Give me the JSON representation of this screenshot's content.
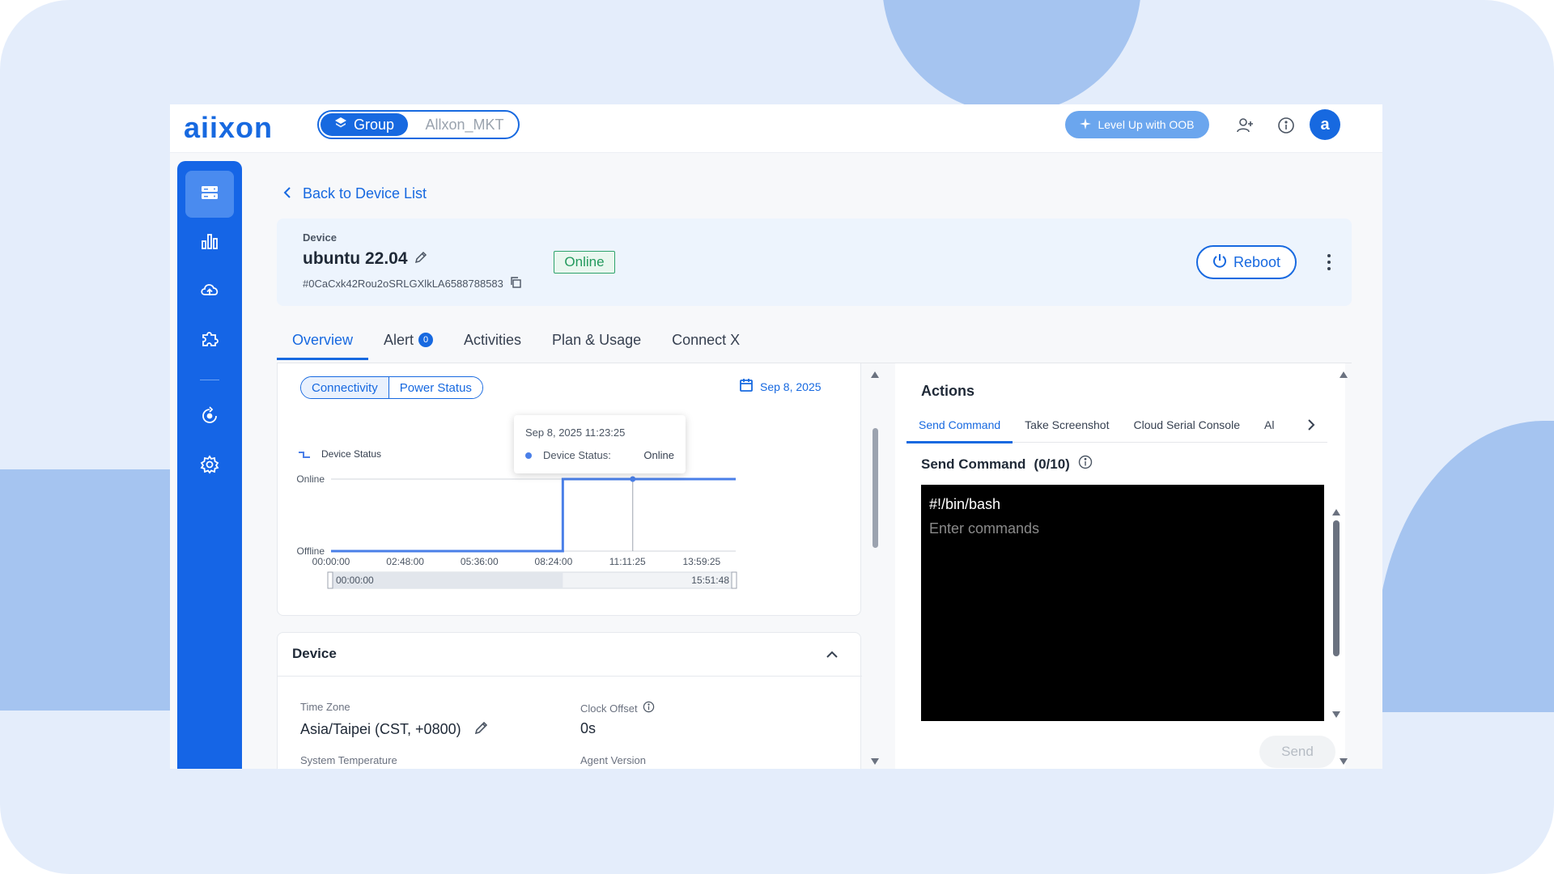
{
  "brand": {
    "logo_text": "aiixon",
    "accent": "#1769e0",
    "online_color": "#239a5d"
  },
  "topbar": {
    "group_label": "Group",
    "group_name": "Allxon_MKT",
    "levelup_label": "Level Up with OOB",
    "avatar_letter": "a",
    "icons": [
      "layers-icon",
      "sparkle-icon",
      "add-user-icon",
      "info-icon"
    ]
  },
  "sidebar": {
    "items": [
      {
        "icon": "devices-icon",
        "active": true
      },
      {
        "icon": "bar-chart-icon",
        "active": false
      },
      {
        "icon": "cloud-icon",
        "active": false
      },
      {
        "icon": "puzzle-icon",
        "active": false
      },
      {
        "icon": "sync-icon",
        "active": false
      },
      {
        "icon": "settings-icon",
        "active": false
      }
    ]
  },
  "header": {
    "back_label": "Back to Device List",
    "device_label": "Device",
    "device_name": "ubuntu 22.04",
    "device_id": "#0CaCxk42Rou2oSRLGXlkLA6588788583",
    "status": "Online",
    "reboot_label": "Reboot"
  },
  "tabs": [
    {
      "label": "Overview",
      "active": true
    },
    {
      "label": "Alert",
      "count": "0"
    },
    {
      "label": "Activities"
    },
    {
      "label": "Plan & Usage"
    },
    {
      "label": "Connect X"
    }
  ],
  "chart_panel": {
    "toggle": [
      "Connectivity",
      "Power Status"
    ],
    "date": "Sep 8, 2025",
    "tooltip": {
      "title": "Sep 8, 2025 11:23:25",
      "series": "Device Status:",
      "value": "Online"
    },
    "range_start": "00:00:00",
    "range_end": "15:51:48"
  },
  "chart_data": {
    "type": "line",
    "title": "",
    "series": [
      {
        "name": "Device Status",
        "x": [
          "00:00:00",
          "08:45:00",
          "08:45:00",
          "15:51:48"
        ],
        "values": [
          "Offline",
          "Offline",
          "Online",
          "Online"
        ]
      }
    ],
    "x_ticks": [
      "00:00:00",
      "02:48:00",
      "05:36:00",
      "08:24:00",
      "11:11:25",
      "13:59:25"
    ],
    "y_categories": [
      "Offline",
      "Online"
    ],
    "legend": "top-left",
    "grid": false,
    "hover_marker": "11:23:25"
  },
  "device_section": {
    "title": "Device",
    "fields": [
      {
        "label": "Time Zone",
        "value": "Asia/Taipei (CST, +0800)"
      },
      {
        "label": "Clock Offset",
        "value": "0s"
      },
      {
        "label": "System Temperature",
        "value": ""
      },
      {
        "label": "Agent Version",
        "value": ""
      }
    ]
  },
  "actions": {
    "title": "Actions",
    "sub_tabs": [
      "Send Command",
      "Take Screenshot",
      "Cloud Serial Console",
      "Al"
    ],
    "send_command_title": "Send Command",
    "send_command_count": "(0/10)",
    "shebang": "#!/bin/bash",
    "input_value": "",
    "input_placeholder": "Enter commands",
    "send_label": "Send"
  }
}
